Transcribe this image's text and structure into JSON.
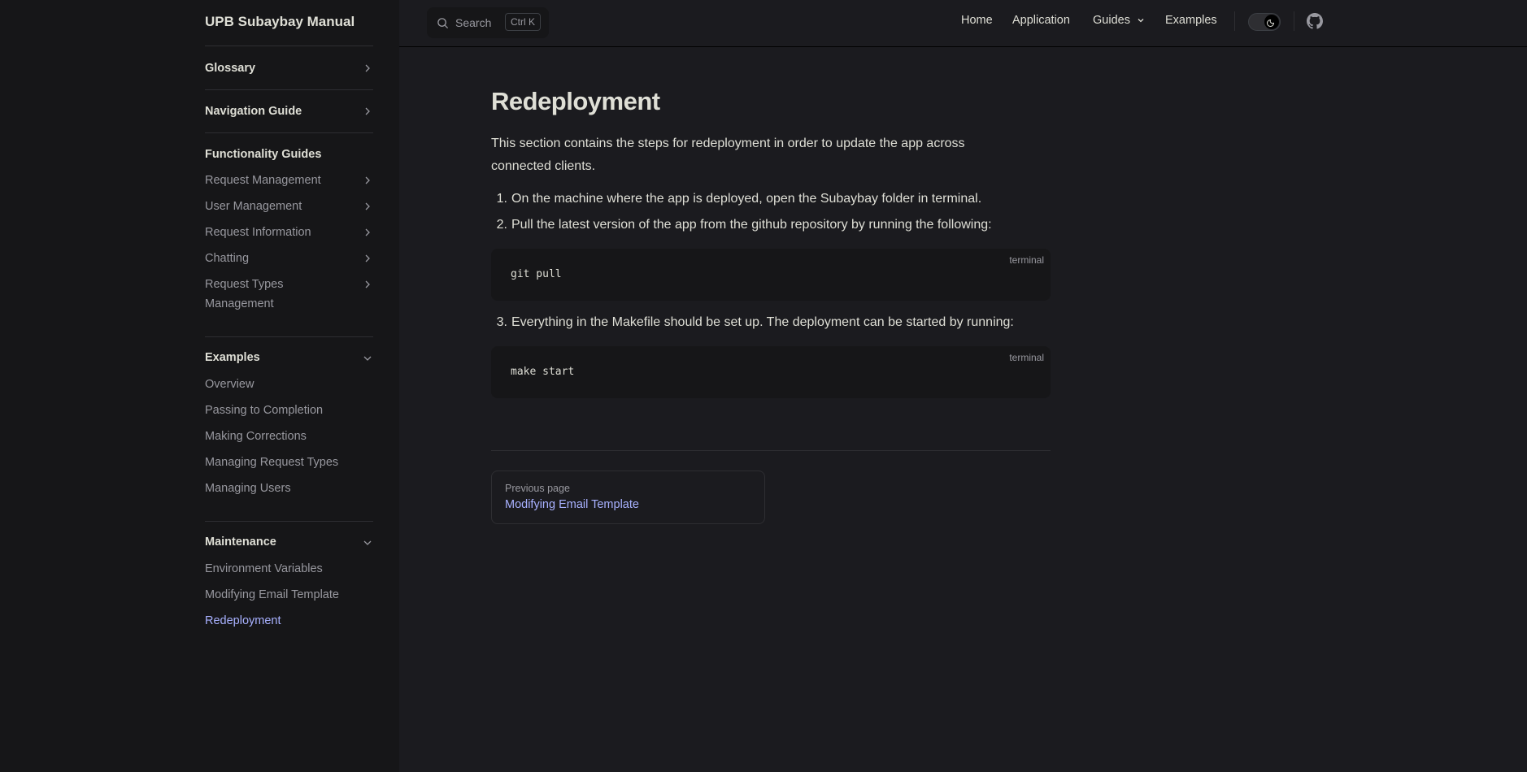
{
  "site": {
    "title": "UPB Subaybay Manual"
  },
  "sidebar": {
    "glossary": "Glossary",
    "navigation_guide": "Navigation Guide",
    "functionality": {
      "title": "Functionality Guides",
      "items": [
        "Request Management",
        "User Management",
        "Request Information",
        "Chatting",
        "Request Types Management"
      ]
    },
    "examples": {
      "title": "Examples",
      "items": [
        "Overview",
        "Passing to Completion",
        "Making Corrections",
        "Managing Request Types",
        "Managing Users"
      ]
    },
    "maintenance": {
      "title": "Maintenance",
      "items": [
        "Environment Variables",
        "Modifying Email Template",
        "Redeployment"
      ]
    }
  },
  "topbar": {
    "search_label": "Search",
    "search_shortcut": "Ctrl K",
    "nav": [
      "Home",
      "Application",
      "Guides",
      "Examples"
    ]
  },
  "page": {
    "title": "Redeployment",
    "intro": "This section contains the steps for redeployment in order to update the app across connected clients.",
    "steps": [
      "On the machine where the app is deployed, open the Subaybay folder in terminal.",
      "Pull the latest version of the app from the github repository by running the following:",
      "Everything in the Makefile should be set up. The deployment can be started by running:"
    ],
    "code_blocks": [
      {
        "lang": "terminal",
        "code": "git pull"
      },
      {
        "lang": "terminal",
        "code": "make start"
      }
    ],
    "prev": {
      "desc": "Previous page",
      "title": "Modifying Email Template"
    }
  },
  "colors": {
    "accent": "#a8b1ff",
    "bg": "#1b1b1f",
    "sidebar_bg": "#161618"
  }
}
